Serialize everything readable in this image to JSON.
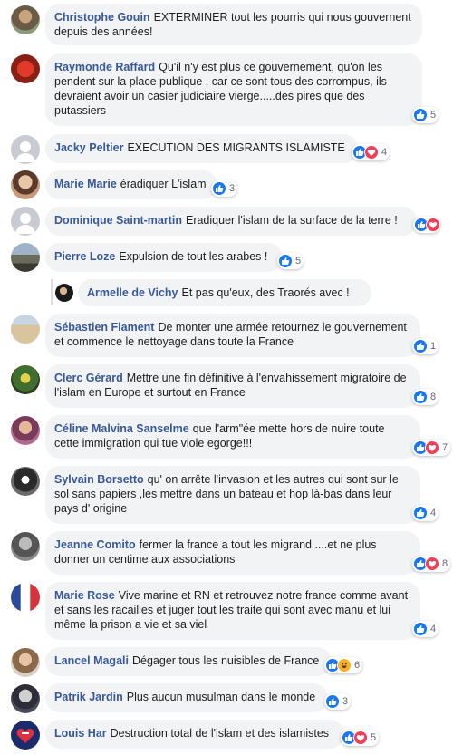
{
  "comments": [
    {
      "name": "Christophe Gouin",
      "text": "EXTERMINER tout les pourris qui nous gouvernent depuis des années!",
      "count": ""
    },
    {
      "name": "Raymonde Raffard",
      "text": "Qu'il n'y est plus ce gouvernement, qu'on les pendent sur la place publique , car ce sont tous des corrompus, ils devraient avoir un casier judiciaire vierge.....des pires que des putassiers",
      "count": "5"
    },
    {
      "name": "Jacky Peltier",
      "text": "EXECUTION DES MIGRANTS ISLAMISTE",
      "count": "4"
    },
    {
      "name": "Marie Marie",
      "text": "éradiquer L'islam",
      "count": "3"
    },
    {
      "name": "Dominique Saint-martin",
      "text": "Eradiquer l'islam de la surface de la terre !",
      "count": ""
    },
    {
      "name": "Pierre Loze",
      "text": "Expulsion de tout les arabes !",
      "count": "5"
    },
    {
      "name": "Armelle de Vichy",
      "text": "Et pas qu'eux, des Traorés avec !",
      "count": ""
    },
    {
      "name": "Sébastien Flament",
      "text": "De monter une armée retournez le gouvernement et commence le nettoyage dans toute la France",
      "count": "1"
    },
    {
      "name": "Clerc Gérard",
      "text": "Mettre une fin définitive à l'envahissement migratoire de l'islam en Europe et surtout en France",
      "count": "8"
    },
    {
      "name": "Céline Malvina Sanselme",
      "text": "que l'arm\"ée mette hors de nuire toute cette immigration qui tue viole egorge!!!",
      "count": "7"
    },
    {
      "name": "Sylvain Borsetto",
      "text": "qu' on arrête l'invasion et les autres qui sont sur le sol sans papiers ,les mettre dans un bateau et hop là-bas dans leur pays d' origine",
      "count": "4"
    },
    {
      "name": "Jeanne Comito",
      "text": "fermer la france a tout les migrand ....et ne plus donner un centime aux associations",
      "count": "8"
    },
    {
      "name": "Marie Rose",
      "text": "Vive marine et RN et retrouvez notre france comme avant et sans les racailles et juger tout les traite qui sont avec manu et lui même la prison a vie et sa viel",
      "count": "4"
    },
    {
      "name": "Lancel Magali",
      "text": "Dégager tous les nuisibles de France",
      "count": "6"
    },
    {
      "name": "Patrik Jardin",
      "text": "Plus aucun musulman dans le monde",
      "count": "3"
    },
    {
      "name": "Louis Har",
      "text": "Destruction total de l'islam et des islamistes",
      "count": "5"
    }
  ],
  "colors": {
    "link": "#385898",
    "bubble": "#f2f3f5",
    "like": "#1877f2",
    "love": "#f33e58",
    "haha": "#f7b125"
  },
  "icons": {
    "like": "like-icon",
    "love": "love-icon",
    "haha": "haha-icon"
  }
}
